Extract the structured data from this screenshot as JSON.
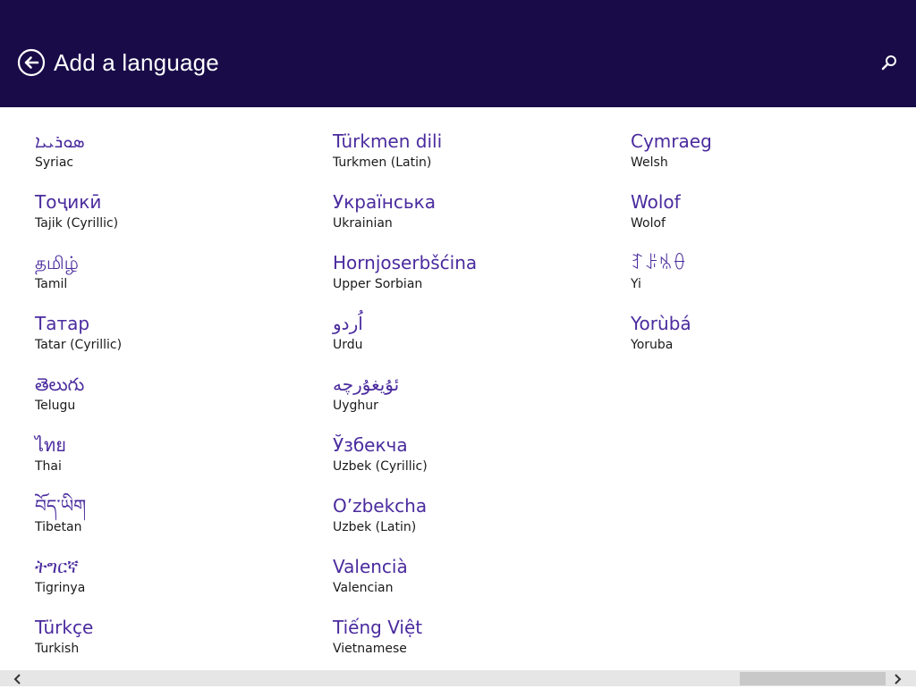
{
  "header": {
    "title": "Add a language",
    "background_color": "#180b48",
    "back_icon": "back-arrow-circle-icon",
    "search_icon": "search-icon"
  },
  "accent_color": "#4a2b9e",
  "columns": [
    [
      {
        "native": "ܣܘܪܝܝܐ",
        "english": "Syriac"
      },
      {
        "native": "Тоҷикӣ",
        "english": "Tajik (Cyrillic)"
      },
      {
        "native": "தமிழ்",
        "english": "Tamil"
      },
      {
        "native": "Татар",
        "english": "Tatar (Cyrillic)"
      },
      {
        "native": "తెలుగు",
        "english": "Telugu"
      },
      {
        "native": "ไทย",
        "english": "Thai"
      },
      {
        "native": "བོད་ཡིག",
        "english": "Tibetan"
      },
      {
        "native": "ትግርኛ",
        "english": "Tigrinya"
      },
      {
        "native": "Türkçe",
        "english": "Turkish"
      }
    ],
    [
      {
        "native": "Türkmen dili",
        "english": "Turkmen (Latin)"
      },
      {
        "native": "Українська",
        "english": "Ukrainian"
      },
      {
        "native": "Hornjoserbšćina",
        "english": "Upper Sorbian"
      },
      {
        "native": "اُردو",
        "english": "Urdu"
      },
      {
        "native": "ئۇيغۇرچە",
        "english": "Uyghur"
      },
      {
        "native": "Ўзбекча",
        "english": "Uzbek (Cyrillic)"
      },
      {
        "native": "O’zbekcha",
        "english": "Uzbek (Latin)"
      },
      {
        "native": "Valencià",
        "english": "Valencian"
      },
      {
        "native": "Tiếng Việt",
        "english": "Vietnamese"
      }
    ],
    [
      {
        "native": "Cymraeg",
        "english": "Welsh"
      },
      {
        "native": "Wolof",
        "english": "Wolof"
      },
      {
        "native": "ꆈꌠꁱꂷ",
        "english": "Yi"
      },
      {
        "native": "Yorùbá",
        "english": "Yoruba"
      }
    ]
  ],
  "scrollbar": {
    "left_icon": "chevron-left-icon",
    "right_icon": "chevron-right-icon"
  }
}
